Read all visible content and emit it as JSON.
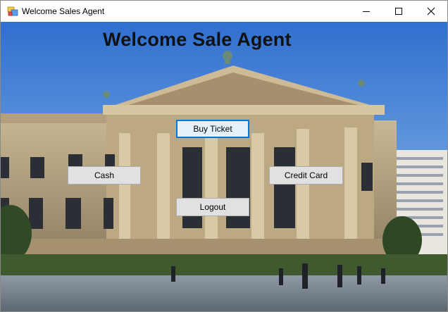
{
  "window": {
    "title": "Welcome Sales Agent",
    "app_icon": "winforms-app-icon",
    "controls": [
      "minimize-icon",
      "maximize-icon",
      "close-icon"
    ]
  },
  "form": {
    "heading": "Welcome Sale Agent",
    "background_image": "museum-building-photo",
    "buttons": {
      "buy_ticket": "Buy Ticket",
      "cash": "Cash",
      "credit_card": "Credit Card",
      "logout": "Logout"
    }
  },
  "colors": {
    "focus_border": "#0078d7",
    "button_face": "#e1e1e1",
    "sky": "#5b8fd6"
  }
}
